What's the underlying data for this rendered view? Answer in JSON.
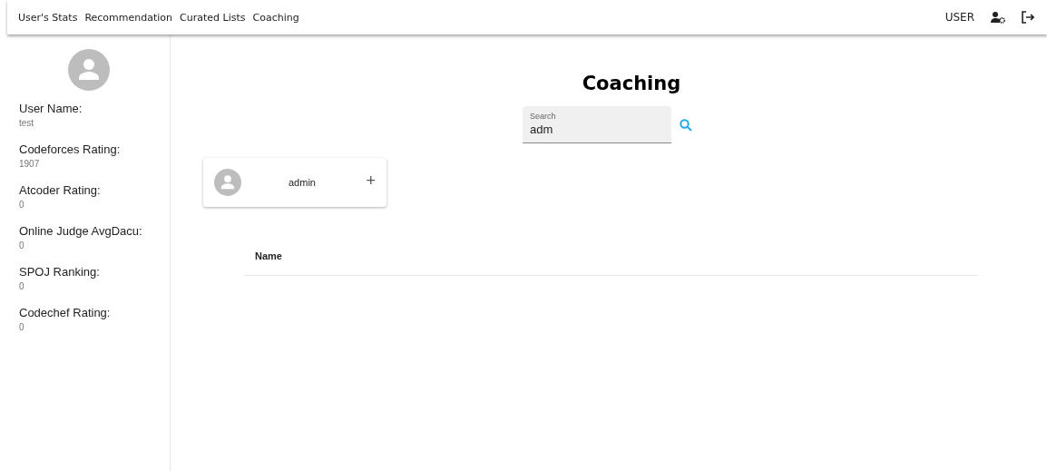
{
  "nav": {
    "links": [
      "User's Stats",
      "Recommendation",
      "Curated Lists",
      "Coaching"
    ],
    "user": "USER"
  },
  "sidebar": {
    "fields": [
      {
        "label": "User Name:",
        "value": "test"
      },
      {
        "label": "Codeforces Rating:",
        "value": "1907"
      },
      {
        "label": "Atcoder Rating:",
        "value": "0"
      },
      {
        "label": "Online Judge AvgDacu:",
        "value": "0"
      },
      {
        "label": "SPOJ Ranking:",
        "value": "0"
      },
      {
        "label": "Codechef Rating:",
        "value": "0"
      }
    ]
  },
  "page": {
    "title": "Coaching",
    "search": {
      "label": "Search",
      "value": "adm"
    },
    "results": [
      {
        "name": "admin",
        "action": "+"
      }
    ],
    "table": {
      "columns": [
        "Name"
      ]
    }
  }
}
